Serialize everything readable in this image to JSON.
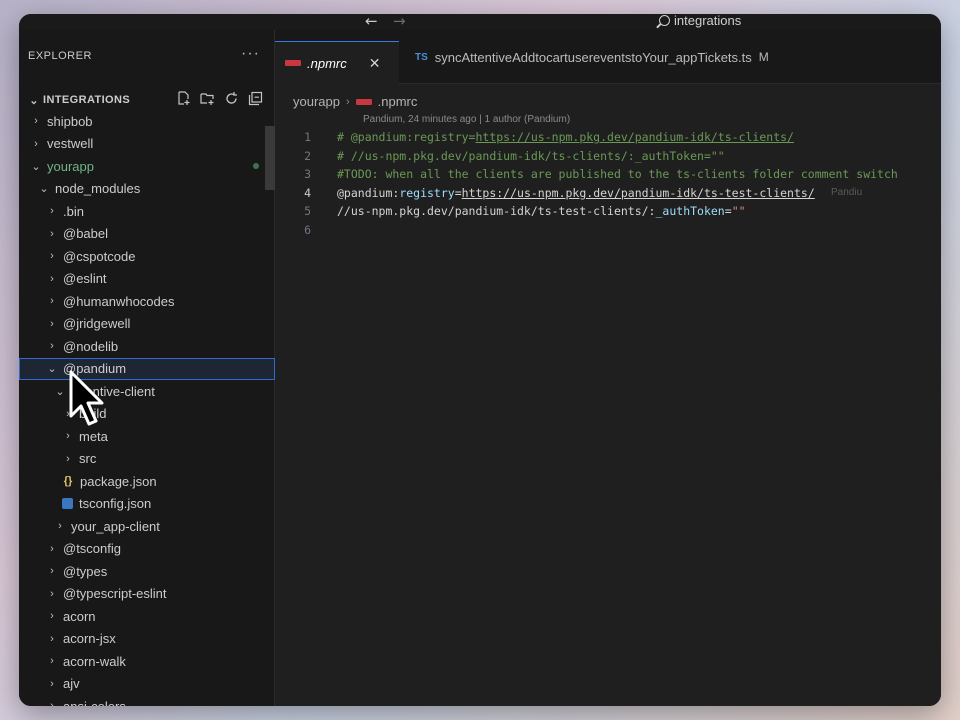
{
  "titlebar": {
    "back_arrow": "←",
    "forward_arrow": "→",
    "search_text": "integrations"
  },
  "sidebar": {
    "title": "EXPLORER",
    "more": "···",
    "section_title": "INTEGRATIONS",
    "tree": [
      {
        "label": "shipbob",
        "chev": "›",
        "depth": 0
      },
      {
        "label": "vestwell",
        "chev": "›",
        "depth": 0
      },
      {
        "label": "yourapp",
        "chev": "⌄",
        "depth": 0,
        "modified": true,
        "color": "#6fb585"
      },
      {
        "label": "node_modules",
        "chev": "⌄",
        "depth": 1
      },
      {
        "label": ".bin",
        "chev": "›",
        "depth": 2
      },
      {
        "label": "@babel",
        "chev": "›",
        "depth": 2
      },
      {
        "label": "@cspotcode",
        "chev": "›",
        "depth": 2
      },
      {
        "label": "@eslint",
        "chev": "›",
        "depth": 2
      },
      {
        "label": "@humanwhocodes",
        "chev": "›",
        "depth": 2
      },
      {
        "label": "@jridgewell",
        "chev": "›",
        "depth": 2
      },
      {
        "label": "@nodelib",
        "chev": "›",
        "depth": 2
      },
      {
        "label": "@pandium",
        "chev": "⌄",
        "depth": 2,
        "selected": true
      },
      {
        "label": "attentive-client",
        "chev": "⌄",
        "depth": 3
      },
      {
        "label": "build",
        "chev": "›",
        "depth": 4
      },
      {
        "label": "meta",
        "chev": "›",
        "depth": 4
      },
      {
        "label": "src",
        "chev": "›",
        "depth": 4
      },
      {
        "label": "package.json",
        "icon": "json",
        "depth": 4
      },
      {
        "label": "tsconfig.json",
        "icon": "ts",
        "depth": 4
      },
      {
        "label": "your_app-client",
        "chev": "›",
        "depth": 3
      },
      {
        "label": "@tsconfig",
        "chev": "›",
        "depth": 2
      },
      {
        "label": "@types",
        "chev": "›",
        "depth": 2
      },
      {
        "label": "@typescript-eslint",
        "chev": "›",
        "depth": 2
      },
      {
        "label": "acorn",
        "chev": "›",
        "depth": 2
      },
      {
        "label": "acorn-jsx",
        "chev": "›",
        "depth": 2
      },
      {
        "label": "acorn-walk",
        "chev": "›",
        "depth": 2
      },
      {
        "label": "ajv",
        "chev": "›",
        "depth": 2
      },
      {
        "label": "ansi-colors",
        "chev": "›",
        "depth": 2
      }
    ]
  },
  "editor": {
    "tabs": [
      {
        "label": ".npmrc",
        "close": "✕",
        "active": true
      },
      {
        "label": "syncAttentiveAddtocartusereventstoYour_appTickets.ts",
        "badge": "TS",
        "status": "M"
      }
    ],
    "breadcrumb": [
      "yourapp",
      ".npmrc"
    ],
    "blame": "Pandium, 24 minutes ago | 1 author (Pandium)",
    "ghost_blame": "Pandiu",
    "lines": [
      {
        "n": "1",
        "segments": [
          {
            "t": "# @pandium:registry=",
            "c": "cmt"
          },
          {
            "t": "https://us-npm.pkg.dev/pandium-idk/ts-clients/",
            "c": "cmt",
            "u": true
          }
        ]
      },
      {
        "n": "2",
        "segments": [
          {
            "t": "# //us-npm.pkg.dev/pandium-idk/ts-clients/:_authToken=\"\"",
            "c": "cmt"
          }
        ]
      },
      {
        "n": "3",
        "segments": [
          {
            "t": "#TODO: when all the clients are published to the ts-clients folder comment switch",
            "c": "cmt"
          }
        ]
      },
      {
        "n": "4",
        "segments": [
          {
            "t": "@pandium:",
            "c": "plain"
          },
          {
            "t": "registry",
            "c": "key"
          },
          {
            "t": "=",
            "c": "plain"
          },
          {
            "t": "https://us-npm.pkg.dev/pandium-idk/ts-test-clients/",
            "c": "url"
          }
        ],
        "current": true
      },
      {
        "n": "5",
        "segments": [
          {
            "t": "//us-npm.pkg.dev/pandium-idk/ts-test-clients/:",
            "c": "plain"
          },
          {
            "t": "_authToken",
            "c": "key"
          },
          {
            "t": "=",
            "c": "plain"
          },
          {
            "t": "\"\"",
            "c": "str"
          }
        ]
      },
      {
        "n": "6",
        "segments": []
      }
    ]
  },
  "colors": {
    "accent": "#3b7be0",
    "npm_red": "#c9383e",
    "comment": "#6a9955",
    "modified_green": "#6fb585"
  }
}
